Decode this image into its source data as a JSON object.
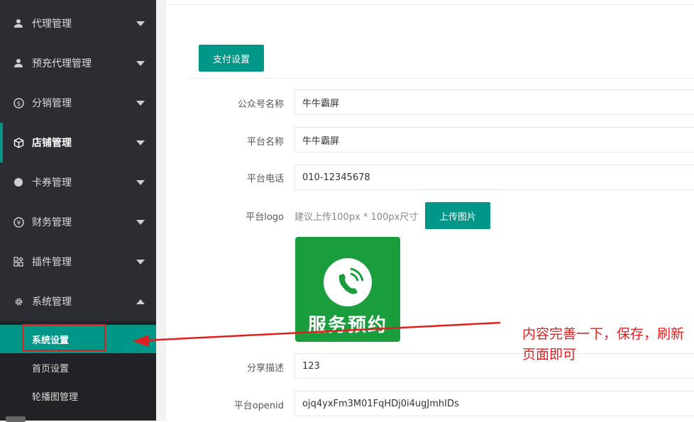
{
  "sidebar": {
    "items": [
      {
        "label": "代理管理",
        "icon": "user-icon"
      },
      {
        "label": "预充代理管理",
        "icon": "user-icon"
      },
      {
        "label": "分销管理",
        "icon": "dollar-icon"
      },
      {
        "label": "店铺管理",
        "icon": "cube-icon"
      },
      {
        "label": "卡券管理",
        "icon": "circle-icon"
      },
      {
        "label": "财务管理",
        "icon": "yen-icon"
      },
      {
        "label": "插件管理",
        "icon": "apps-icon"
      },
      {
        "label": "系统管理",
        "icon": "gear-icon"
      }
    ],
    "subitems": [
      "系统设置",
      "首页设置",
      "轮播图管理"
    ]
  },
  "tab_button": "支付设置",
  "form": {
    "wechat_name_label": "公众号名称",
    "wechat_name_value": "牛牛霸屏",
    "platform_name_label": "平台名称",
    "platform_name_value": "牛牛霸屏",
    "platform_phone_label": "平台电话",
    "platform_phone_value": "010-12345678",
    "platform_logo_label": "平台logo",
    "logo_hint": "建议上传100px * 100px尺寸",
    "upload_button": "上传图片",
    "logo_text": "服务预约",
    "share_desc_label": "分享描述",
    "share_desc_value": "123",
    "openid_label": "平台openid",
    "openid_value": "ojq4yxFm3M01FqHDj0i4ugJmhIDs"
  },
  "annotation": "内容完善一下，保存，刷新页面即可",
  "colors": {
    "accent": "#009688",
    "sidebar_bg": "#2b2d33",
    "annotation": "#e02020",
    "logo_bg": "#1a9e3d"
  }
}
